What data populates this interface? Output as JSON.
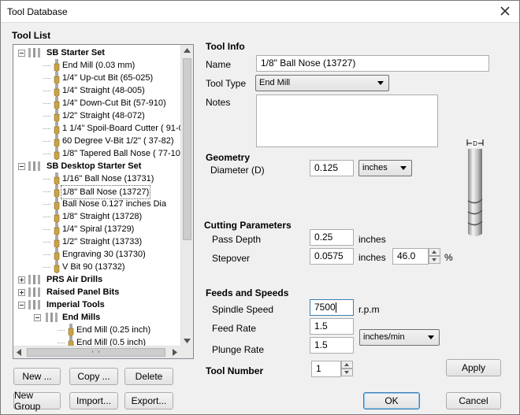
{
  "window": {
    "title": "Tool Database"
  },
  "tool_list": {
    "heading": "Tool List",
    "rows": [
      {
        "label": "SB Starter Set",
        "type": "group",
        "expanded": true
      },
      {
        "label": "End Mill (0.03 mm)",
        "type": "tool"
      },
      {
        "label": "1/4\" Up-cut Bit (65-025)",
        "type": "tool"
      },
      {
        "label": "1/4\" Straight  (48-005)",
        "type": "tool"
      },
      {
        "label": "1/4\"  Down-Cut Bit (57-910)",
        "type": "tool"
      },
      {
        "label": "1/2\" Straight  (48-072)",
        "type": "tool"
      },
      {
        "label": "1 1/4\" Spoil-Board Cutter  ( 91-0",
        "type": "tool"
      },
      {
        "label": "60 Degree V-Bit 1/2\"  ( 37-82)",
        "type": "tool"
      },
      {
        "label": "1/8\" Tapered Ball Nose  ( 77-10",
        "type": "tool"
      },
      {
        "label": "SB Desktop Starter Set",
        "type": "group",
        "expanded": true
      },
      {
        "label": "1/16\" Ball Nose (13731)",
        "type": "tool"
      },
      {
        "label": "1/8\" Ball Nose (13727)",
        "type": "tool",
        "selected": true
      },
      {
        "label": "Ball Nose 0.127 inches Dia",
        "type": "tool"
      },
      {
        "label": "1/8\" Straight (13728)",
        "type": "tool"
      },
      {
        "label": "1/4\" Spiral (13729)",
        "type": "tool"
      },
      {
        "label": "1/2\" Straight (13733)",
        "type": "tool"
      },
      {
        "label": "Engraving 30 (13730)",
        "type": "tool"
      },
      {
        "label": "V Bit 90 (13732)",
        "type": "tool"
      },
      {
        "label": "PRS Air Drills",
        "type": "group",
        "expanded": false
      },
      {
        "label": "Raised Panel Bits",
        "type": "group",
        "expanded": false
      },
      {
        "label": "Imperial Tools",
        "type": "group",
        "expanded": true
      },
      {
        "label": "End Mills",
        "type": "subgroup",
        "expanded": true
      },
      {
        "label": "End Mill (0.25 inch)",
        "type": "subtool"
      },
      {
        "label": "End Mill (0.5 inch)",
        "type": "subtool"
      }
    ]
  },
  "buttons": {
    "new": "New ...",
    "copy": "Copy ...",
    "delete": "Delete",
    "new_group": "New Group",
    "import": "Import...",
    "export": "Export...",
    "apply": "Apply",
    "ok": "OK",
    "cancel": "Cancel"
  },
  "tool_info": {
    "heading": "Tool Info",
    "name_label": "Name",
    "name_value": "1/8\" Ball Nose (13727)",
    "type_label": "Tool Type",
    "type_value": "End Mill",
    "notes_label": "Notes"
  },
  "geometry": {
    "heading": "Geometry",
    "diameter_label": "Diameter (D)",
    "diameter_value": "0.125",
    "units_value": "inches",
    "diagram_label": "D"
  },
  "cutting": {
    "heading": "Cutting Parameters",
    "pass_depth_label": "Pass Depth",
    "pass_depth_value": "0.25",
    "pass_depth_unit": "inches",
    "stepover_label": "Stepover",
    "stepover_value": "0.0575",
    "stepover_unit": "inches",
    "stepover_percent": "46.0",
    "percent_sign": "%"
  },
  "feeds": {
    "heading": "Feeds and Speeds",
    "spindle_label": "Spindle Speed",
    "spindle_value": "7500",
    "spindle_unit": "r.p.m",
    "feed_label": "Feed Rate",
    "feed_value": "1.5",
    "plunge_label": "Plunge Rate",
    "plunge_value": "1.5",
    "rate_units": "inches/min"
  },
  "tool_number": {
    "label": "Tool Number",
    "value": "1"
  },
  "colors": {
    "accent": "#3c7fb1",
    "window_bg": "#f0f0f0",
    "bit_gold": "#c9a24a"
  }
}
